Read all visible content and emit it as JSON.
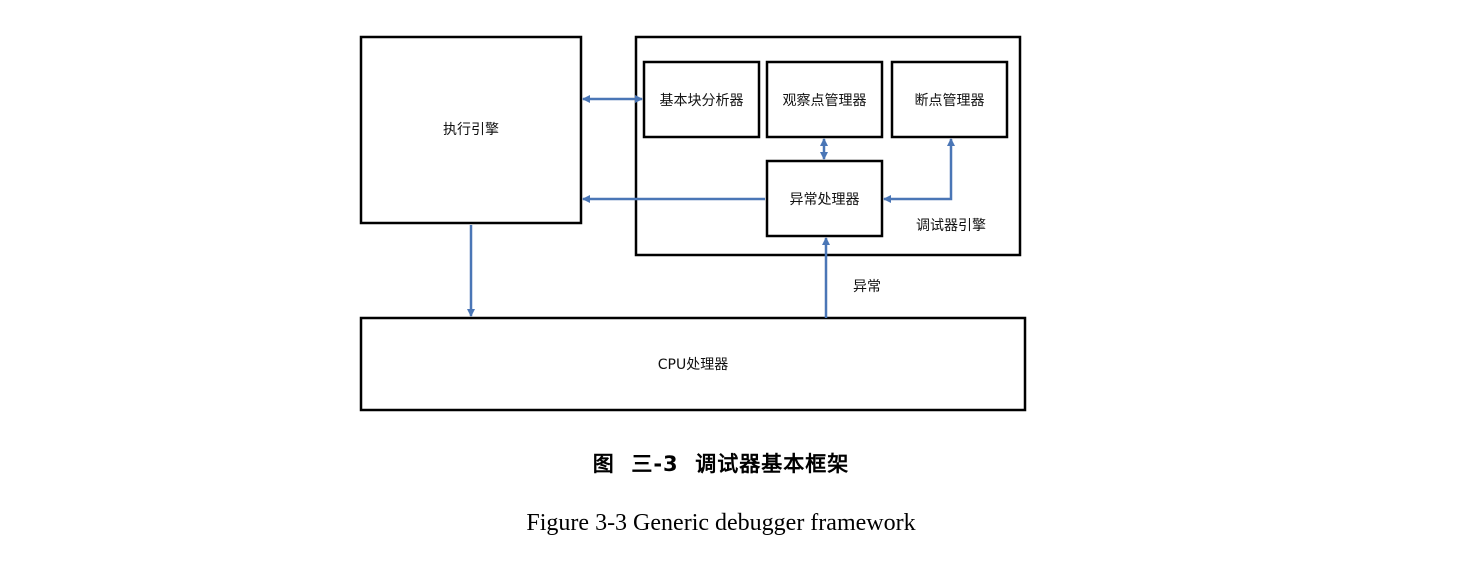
{
  "diagram": {
    "nodes": {
      "execution_engine": "执行引擎",
      "debugger_engine": "调试器引擎",
      "basic_block_analyzer": "基本块分析器",
      "watchpoint_manager": "观察点管理器",
      "breakpoint_manager": "断点管理器",
      "exception_handler": "异常处理器",
      "cpu_processor": "CPU处理器"
    },
    "edges": {
      "exception_label": "异常"
    },
    "colors": {
      "connector": "#4a76b6",
      "box_border": "#000000"
    }
  },
  "caption": {
    "chinese": "图  三-3  调试器基本框架",
    "english": "Figure 3-3 Generic debugger framework"
  }
}
